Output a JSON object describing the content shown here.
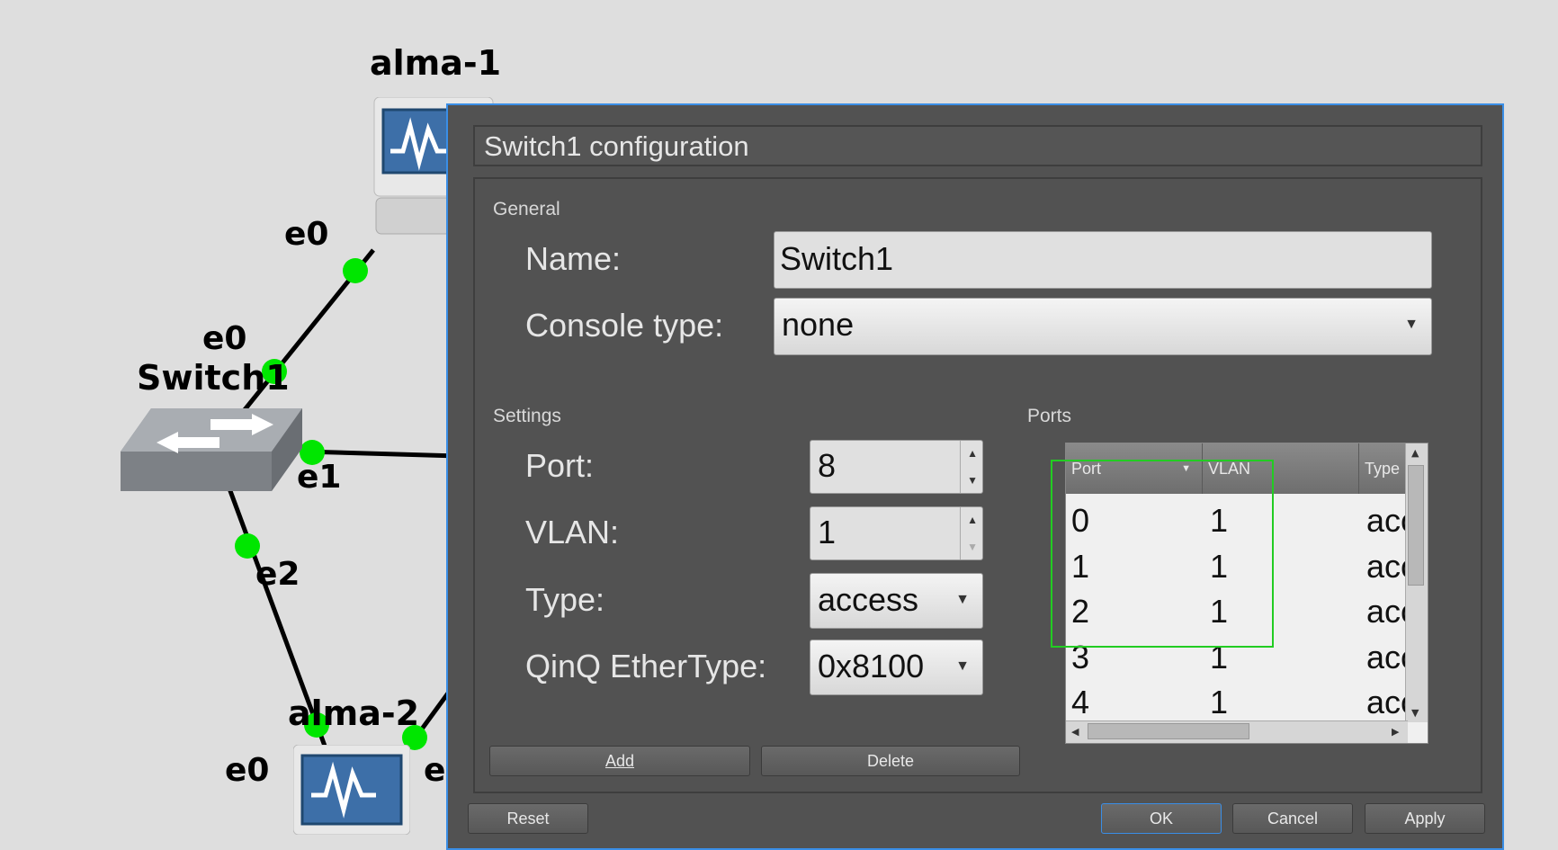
{
  "topology": {
    "nodes": {
      "alma1": {
        "label": "alma-1"
      },
      "switch1": {
        "label": "Switch1"
      },
      "alma2": {
        "label": "alma-2"
      }
    },
    "port_labels": {
      "alma1_e0": "e0",
      "switch_e0": "e0",
      "switch_e1": "e1",
      "switch_e2": "e2",
      "alma2_e0": "e0",
      "alma2_e1_partial": "e"
    },
    "link_dot_color": "#00e600"
  },
  "dialog": {
    "title": "Switch1 configuration",
    "general": {
      "group_title": "General",
      "name_label": "Name:",
      "name_value": "Switch1",
      "console_type_label": "Console type:",
      "console_type_value": "none"
    },
    "settings": {
      "group_title": "Settings",
      "port_label": "Port:",
      "port_value": "8",
      "vlan_label": "VLAN:",
      "vlan_value": "1",
      "type_label": "Type:",
      "type_value": "access",
      "qinq_label": "QinQ EtherType:",
      "qinq_value": "0x8100"
    },
    "ports": {
      "group_title": "Ports",
      "columns": [
        "Port",
        "VLAN",
        "Type"
      ],
      "rows": [
        [
          "0",
          "1",
          "access"
        ],
        [
          "1",
          "1",
          "access"
        ],
        [
          "2",
          "1",
          "access"
        ],
        [
          "3",
          "1",
          "access"
        ],
        [
          "4",
          "1",
          "access"
        ]
      ]
    },
    "buttons": {
      "add": "Add",
      "delete": "Delete",
      "reset": "Reset",
      "ok": "OK",
      "cancel": "Cancel",
      "apply": "Apply"
    },
    "accent_color": "#3a8ee6"
  }
}
